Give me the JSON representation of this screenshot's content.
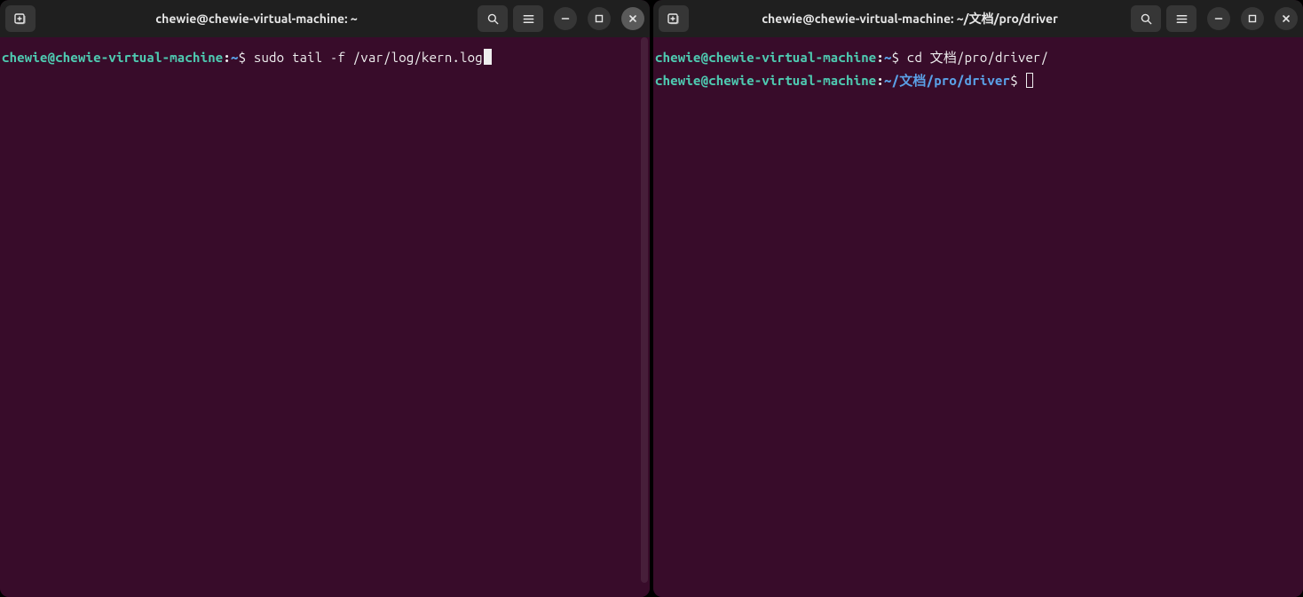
{
  "left_window": {
    "title": "chewie@chewie-virtual-machine: ~",
    "prompt": {
      "user_host": "chewie@chewie-virtual-machine",
      "path": "~",
      "dollar": "$",
      "command": "sudo tail -f /var/log/kern.log"
    }
  },
  "right_window": {
    "title": "chewie@chewie-virtual-machine: ~/文档/pro/driver",
    "line1": {
      "user_host": "chewie@chewie-virtual-machine",
      "path": "~",
      "dollar": "$",
      "command": "cd 文档/pro/driver/"
    },
    "line2": {
      "user_host": "chewie@chewie-virtual-machine",
      "path": "~/文档/pro/driver",
      "dollar": "$",
      "command": ""
    }
  },
  "icons": {
    "new_tab": "new-tab",
    "search": "search",
    "menu": "menu",
    "minimize": "minimize",
    "maximize": "maximize",
    "close": "close"
  }
}
